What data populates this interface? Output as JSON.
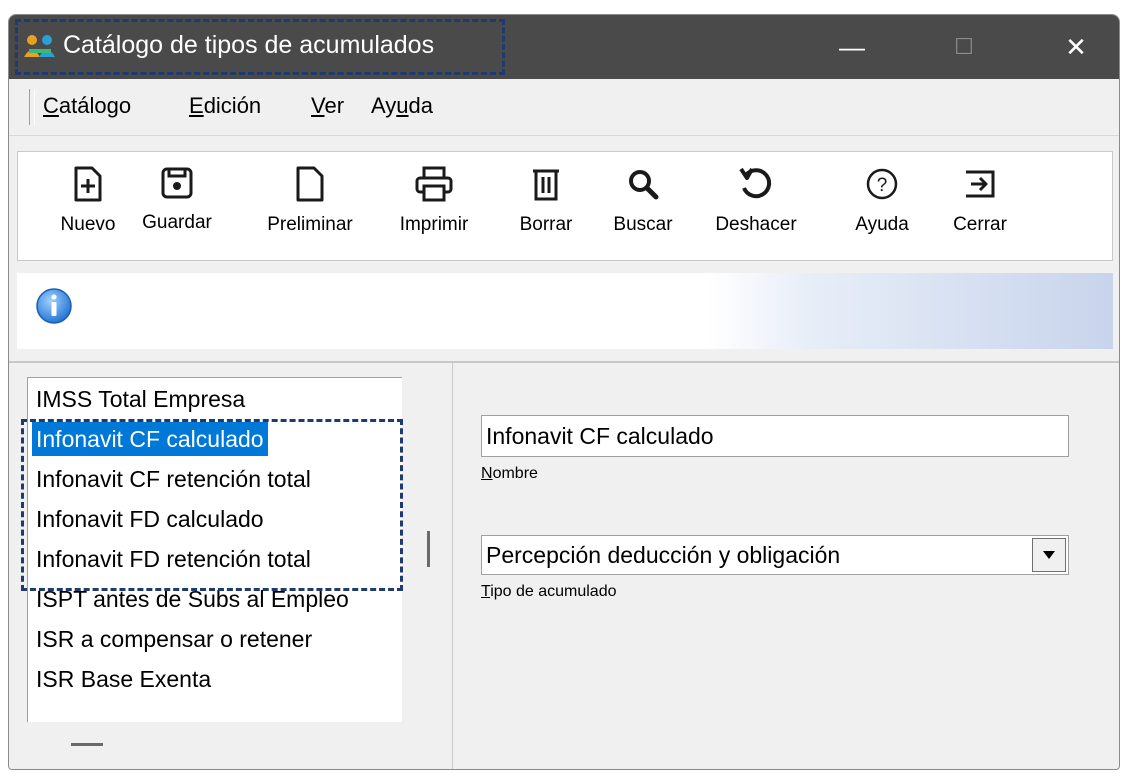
{
  "window": {
    "title": "Catálogo de tipos de acumulados",
    "minimize": "—",
    "maximize": "☐",
    "close": "✕"
  },
  "menu": [
    {
      "pre": "",
      "ul": "C",
      "post": "atálogo"
    },
    {
      "pre": "",
      "ul": "E",
      "post": "dición"
    },
    {
      "pre": "",
      "ul": "V",
      "post": "er"
    },
    {
      "pre": "Ay",
      "ul": "u",
      "post": "da"
    }
  ],
  "toolbar": {
    "nuevo": "Nuevo",
    "guardar": "Guardar",
    "preliminar": "Preliminar",
    "imprimir": "Imprimir",
    "borrar": "Borrar",
    "buscar": "Buscar",
    "deshacer": "Deshacer",
    "ayuda": "Ayuda",
    "cerrar": "Cerrar"
  },
  "list": {
    "items": [
      "IMSS Total Empresa",
      "Infonavit CF calculado",
      "Infonavit CF retención total",
      "Infonavit FD calculado",
      "Infonavit FD retención total",
      "ISPT antes de Subs al Empleo",
      "ISR  a compensar o retener",
      "ISR Base Exenta"
    ],
    "selected_index": 1
  },
  "form": {
    "nombre_value": "Infonavit CF calculado",
    "nombre_label_ul": "N",
    "nombre_label_rest": "ombre",
    "tipo_value": "Percepción deducción y obligación",
    "tipo_label_ul": "T",
    "tipo_label_rest": "ipo de acumulado"
  },
  "colors": {
    "selection": "#0078d7",
    "highlight_border": "#1e3a6e",
    "titlebar": "#4a4a4a"
  }
}
